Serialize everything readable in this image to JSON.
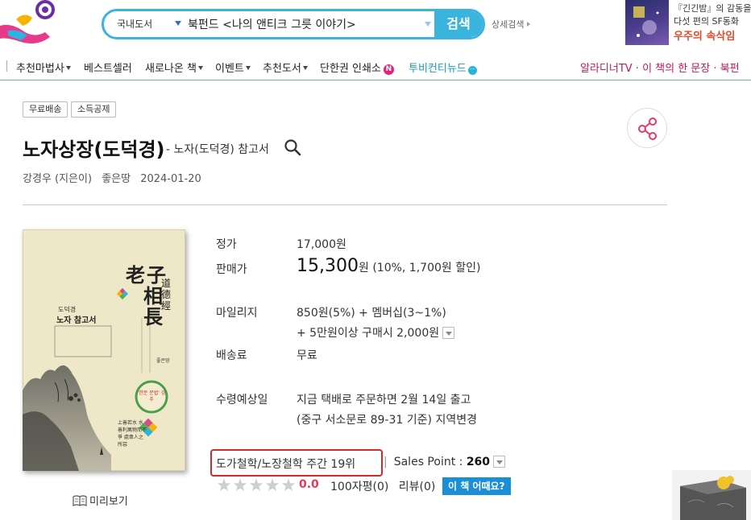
{
  "header": {
    "search_category": "국내도서",
    "search_value": "북펀드 <나의 앤티크 그릇 이야기>",
    "search_button": "검색",
    "detail_search": "상세검색"
  },
  "ad": {
    "line1": "『긴긴밤』의 감동을 잇",
    "line2": "다섯 편의 SF동화",
    "line3": "우주의 속삭임"
  },
  "nav": {
    "items": [
      "추천마법사",
      "베스트셀러",
      "새로나온 책",
      "이벤트",
      "추천도서",
      "단한권 인쇄소",
      "투비컨티뉴드"
    ],
    "badge_n": "N",
    "badge_dots": "···",
    "right": "알라디너TV · 이 책의 한 문장 · 북펀"
  },
  "product": {
    "tags": [
      "무료배송",
      "소득공제"
    ],
    "title": "노자상장(도덕경)",
    "subtitle": "- 노자(도덕경) 참고서",
    "author": "강경우 (지은이)",
    "publisher": "좋은땅",
    "date": "2024-01-20",
    "preview": "미리보기"
  },
  "cover": {
    "big_chars": [
      "老",
      "子",
      "相",
      "長"
    ],
    "side_chars": "道德經",
    "left_title1": "도덕경",
    "left_title2": "노자 참고서",
    "circle_text": "'한문 문법' 강추",
    "quote": "上善若水 水善利萬物而不爭 處衆人之所惡",
    "publisher": "좋은땅"
  },
  "info": {
    "list_price_label": "정가",
    "list_price": "17,000원",
    "sale_price_label": "판매가",
    "sale_price": "15,300",
    "sale_price_unit": "원",
    "discount": "(10%, 1,700원 할인)",
    "mileage_label": "마일리지",
    "mileage_line1": "850원(5%) + 멤버십(3~1%)",
    "mileage_line2": "+ 5만원이상 구매시 2,000원",
    "shipping_label": "배송료",
    "shipping": "무료",
    "delivery_label": "수령예상일",
    "delivery_line1": "지금 택배로 주문하면 2월 14일 출고",
    "delivery_line2": "(중구 서소문로 89-31 기준) 지역변경",
    "rank": "도가철학/노장철학 주간 19위",
    "sales_label": "Sales Point :",
    "sales_value": "260",
    "rating": "0.0",
    "reviews_100": "100자평(0)",
    "reviews": "리뷰(0)",
    "how_button": "이 책 어때요?"
  },
  "colors": {
    "accent": "#3ab4dc",
    "nav_right": "#c2185b",
    "rank_border": "#d42a2a",
    "rating": "#e03a5a",
    "button_blue": "#1a8ed6"
  },
  "star_rating": 0
}
